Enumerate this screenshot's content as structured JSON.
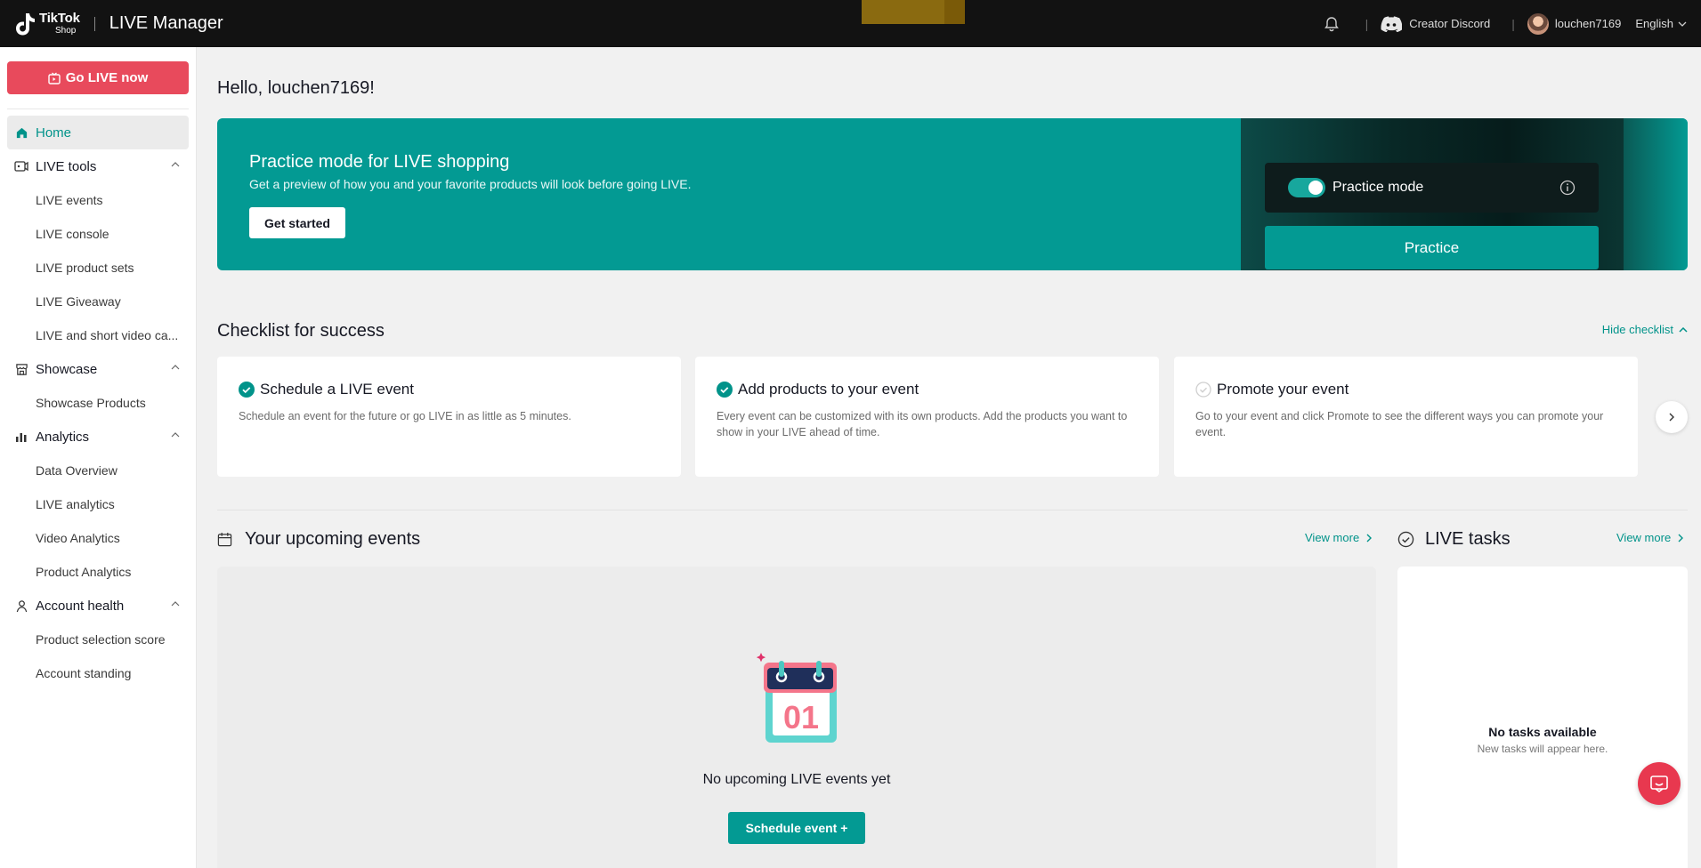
{
  "header": {
    "logo_tiktok": "TikTok",
    "logo_shop": "Shop",
    "app_title": "LIVE Manager",
    "discord_label": "Creator Discord",
    "username": "louchen7169",
    "language": "English"
  },
  "sidebar": {
    "go_live_label": "Go LIVE now",
    "items": [
      {
        "label": "Home"
      },
      {
        "label": "LIVE tools",
        "children": [
          "LIVE events",
          "LIVE console",
          "LIVE product sets",
          "LIVE Giveaway",
          "LIVE and short video ca..."
        ]
      },
      {
        "label": "Showcase",
        "children": [
          "Showcase Products"
        ]
      },
      {
        "label": "Analytics",
        "children": [
          "Data Overview",
          "LIVE analytics",
          "Video Analytics",
          "Product Analytics"
        ]
      },
      {
        "label": "Account health",
        "children": [
          "Product selection score",
          "Account standing"
        ]
      }
    ]
  },
  "main": {
    "greeting": "Hello, louchen7169!",
    "banner": {
      "title": "Practice mode for LIVE shopping",
      "subtitle": "Get a preview of how you and your favorite products will look before going LIVE.",
      "button": "Get started",
      "toggle_label": "Practice mode",
      "practice_button": "Practice"
    },
    "checklist": {
      "title": "Checklist for success",
      "hide_label": "Hide checklist",
      "cards": [
        {
          "title": "Schedule a LIVE event",
          "desc": "Schedule an event for the future or go LIVE in as little as 5 minutes.",
          "done": true
        },
        {
          "title": "Add products to your event",
          "desc": "Every event can be customized with its own products. Add the products you want to show in your LIVE ahead of time.",
          "done": true
        },
        {
          "title": "Promote your event",
          "desc": "Go to your event and click Promote to see the different ways you can promote your event.",
          "done": false
        }
      ]
    },
    "events": {
      "title": "Your upcoming events",
      "view_more": "View more",
      "calendar_day": "01",
      "empty_text": "No upcoming LIVE events yet",
      "schedule_button": "Schedule event +"
    },
    "tasks": {
      "title": "LIVE tasks",
      "view_more": "View more",
      "empty_title": "No tasks available",
      "empty_sub": "New tasks will appear here."
    }
  },
  "colors": {
    "accent": "#039a93",
    "go_live": "#e84a5c",
    "topbar": "#121212"
  }
}
